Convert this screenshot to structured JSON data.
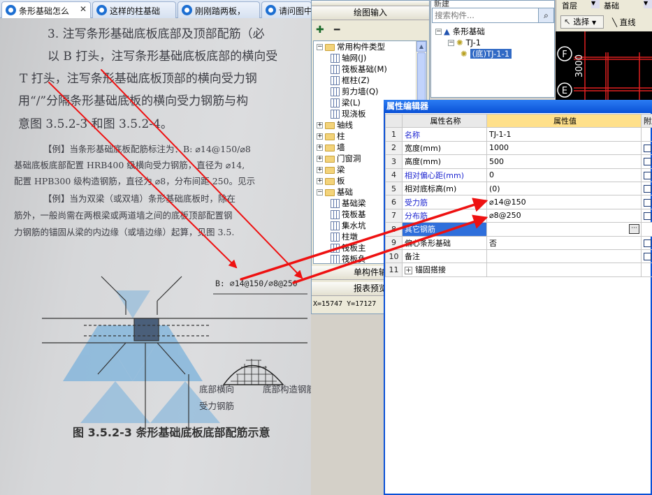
{
  "tabs": [
    {
      "label": "条形基础怎么",
      "active": true
    },
    {
      "label": "这样的柱基础",
      "active": false
    },
    {
      "label": "刚刚踏两板，",
      "active": false
    },
    {
      "label": "请问图中",
      "active": false
    }
  ],
  "photo": {
    "section_lines": [
      "3. 注写条形基础底板底部及顶部配筋（必",
      "以 B 打头，注写条形基础底板底部的横向受",
      "T 打头，注写条形基础底板顶部的横向受力钢",
      "用“/”分隔条形基础底板的横向受力钢筋与构",
      "意图 3.5.2-3 和图 3.5.2-4。"
    ],
    "example1_lines": [
      "【例】当条形基础底板配筋标注为：B: ⌀14@150/⌀8",
      "基础底板底部配置 HRB400 级横向受力钢筋，直径为 ⌀14,",
      "配置 HPB300 级构造钢筋，直径为 ⌀8，分布间距 250。见示"
    ],
    "example2_lines": [
      "【例】当为双梁（或双墙）条形基础底板时，除在",
      "筋外，一般尚需在两根梁或两道墙之间的底板顶部配置钢",
      "力钢筋的锚固从梁的内边缘（或墙边缘）起算，见图 3.5."
    ],
    "figure_rebar_label": "B: ⌀14@150/⌀8@250",
    "figure_bottom_left": [
      "底部横向",
      "受力钢筋"
    ],
    "figure_bottom_right": "底部构造钢筋",
    "figure_caption": "图 3.5.2-3  条形基础底板底部配筋示意"
  },
  "left_panel": {
    "header": "绘图输入",
    "tree": [
      {
        "label": "常用构件类型",
        "indent": 0,
        "expanded": true,
        "icon": "folder-icon"
      },
      {
        "label": "轴网(J)",
        "indent": 2,
        "icon": "grid-icon"
      },
      {
        "label": "筏板基础(M)",
        "indent": 2,
        "icon": "grid-icon"
      },
      {
        "label": "框柱(Z)",
        "indent": 2,
        "icon": "grid-icon"
      },
      {
        "label": "剪力墙(Q)",
        "indent": 2,
        "icon": "grid-icon"
      },
      {
        "label": "梁(L)",
        "indent": 2,
        "icon": "grid-icon"
      },
      {
        "label": "现浇板",
        "indent": 2,
        "icon": "grid-icon"
      },
      {
        "label": "轴线",
        "indent": 0,
        "expanded": false,
        "icon": "folder-icon"
      },
      {
        "label": "柱",
        "indent": 0,
        "expanded": false,
        "icon": "folder-icon"
      },
      {
        "label": "墙",
        "indent": 0,
        "expanded": false,
        "icon": "folder-icon"
      },
      {
        "label": "门窗洞",
        "indent": 0,
        "expanded": false,
        "icon": "folder-icon"
      },
      {
        "label": "梁",
        "indent": 0,
        "expanded": false,
        "icon": "folder-icon"
      },
      {
        "label": "板",
        "indent": 0,
        "expanded": false,
        "icon": "folder-icon"
      },
      {
        "label": "基础",
        "indent": 0,
        "expanded": true,
        "icon": "folder-icon"
      },
      {
        "label": "基础梁",
        "indent": 2,
        "icon": "grid-icon"
      },
      {
        "label": "筏板基",
        "indent": 2,
        "icon": "grid-icon"
      },
      {
        "label": "集水坑",
        "indent": 2,
        "icon": "grid-icon"
      },
      {
        "label": "柱墩",
        "indent": 2,
        "icon": "grid-icon"
      },
      {
        "label": "筏板主",
        "indent": 2,
        "icon": "grid-icon"
      },
      {
        "label": "筏板负",
        "indent": 2,
        "icon": "grid-icon"
      }
    ],
    "button_single": "单构件输",
    "button_report": "报表预览",
    "coordinates": "X=15747 Y=17127"
  },
  "mid_panel": {
    "toolbar": "新建",
    "search_placeholder": "搜索构件...",
    "tree": [
      {
        "label": "条形基础",
        "level": 0
      },
      {
        "label": "TJ-1",
        "level": 1
      },
      {
        "label": "(底)TJ-1-1",
        "level": 2,
        "selected": true
      }
    ]
  },
  "cad": {
    "floor": "首层",
    "layer": "基础",
    "select": "选择",
    "line": "直线",
    "axis_labels": [
      "F",
      "E"
    ],
    "dimension": "3000"
  },
  "property_editor": {
    "title": "属性编辑器",
    "headers": [
      "属性名称",
      "属性值",
      "附加"
    ],
    "rows": [
      {
        "n": "1",
        "name": "名称",
        "value": "TJ-1-1",
        "blue": true,
        "check": false
      },
      {
        "n": "2",
        "name": "宽度(mm)",
        "value": "1000",
        "blue": false,
        "check": true
      },
      {
        "n": "3",
        "name": "高度(mm)",
        "value": "500",
        "blue": false,
        "check": true
      },
      {
        "n": "4",
        "name": "相对偏心距(mm)",
        "value": "0",
        "blue": true,
        "check": true
      },
      {
        "n": "5",
        "name": "相对底标高(m)",
        "value": "(0)",
        "blue": false,
        "check": true
      },
      {
        "n": "6",
        "name": "受力筋",
        "value": "⌀14@150",
        "blue": true,
        "check": true
      },
      {
        "n": "7",
        "name": "分布筋",
        "value": "⌀8@250",
        "blue": true,
        "check": true
      },
      {
        "n": "8",
        "name": "其它钢筋",
        "value": "",
        "blue": false,
        "check": false,
        "selected": true
      },
      {
        "n": "9",
        "name": "偏心条形基础",
        "value": "否",
        "blue": false,
        "check": true
      },
      {
        "n": "10",
        "name": "备注",
        "value": "",
        "blue": false,
        "check": true
      },
      {
        "n": "11",
        "name": "锚固搭接",
        "value": "",
        "blue": false,
        "check": false,
        "expand": true
      }
    ]
  },
  "colors": {
    "annotation_arrow": "#ee1111",
    "title_bar": "#0a51d6",
    "selected_row": "#2f6fdb",
    "header_value_bg": "#ffe08a",
    "cad_bg": "#000000",
    "cad_grid": "#e02020"
  }
}
